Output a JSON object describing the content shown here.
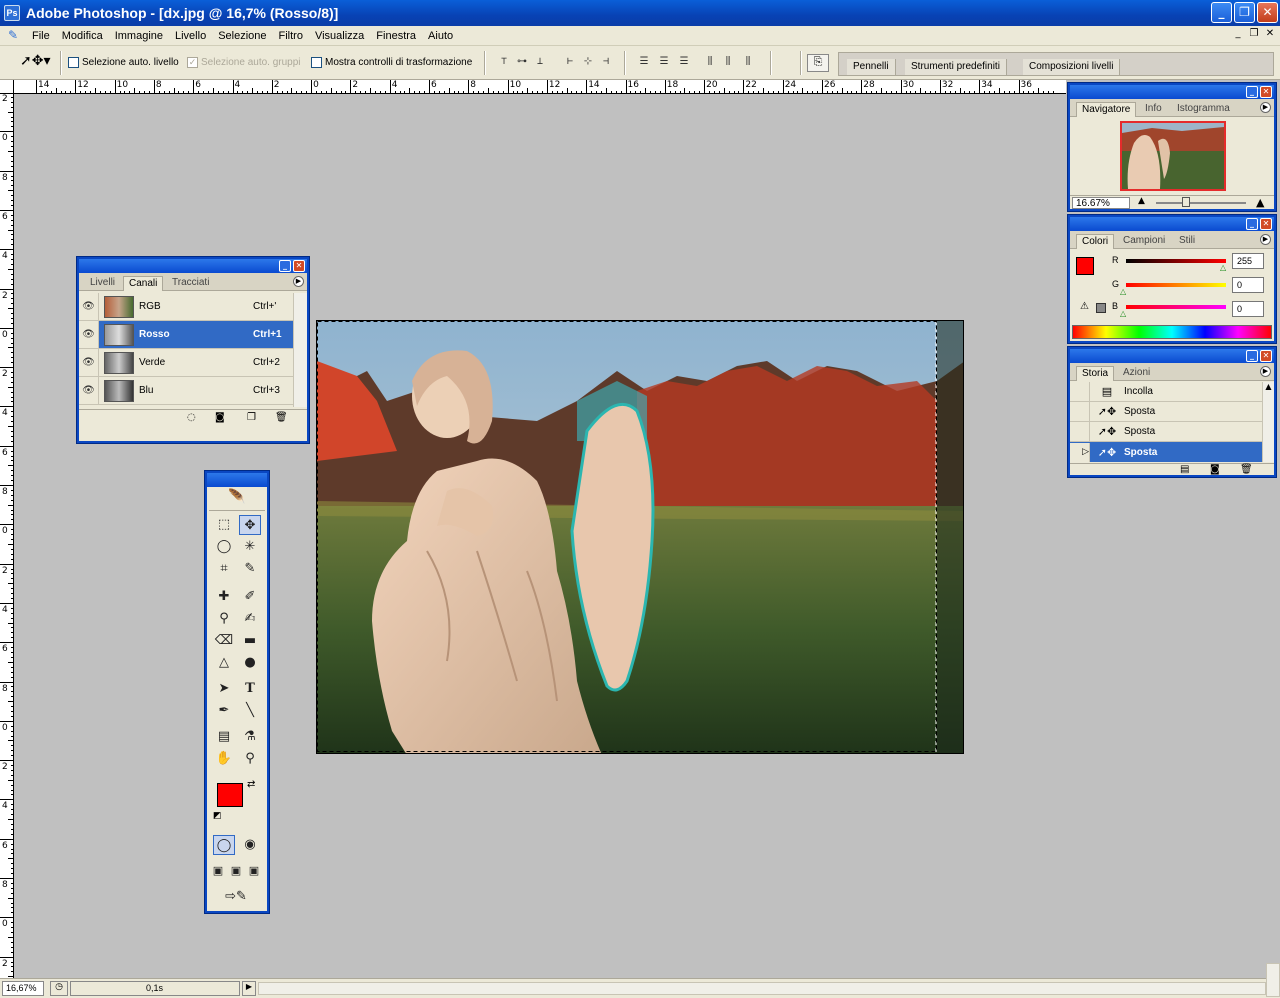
{
  "window": {
    "title": "Adobe Photoshop - [dx.jpg @ 16,7% (Rosso/8)]",
    "minimize": "_",
    "restore": "❐",
    "close": "✕"
  },
  "menu": [
    "File",
    "Modifica",
    "Immagine",
    "Livello",
    "Selezione",
    "Filtro",
    "Visualizza",
    "Finestra",
    "Aiuto"
  ],
  "options": {
    "auto_select_layer": "Selezione auto. livello",
    "auto_select_groups": "Selezione auto. gruppi",
    "show_transform": "Mostra controlli di trasformazione"
  },
  "palette_well": [
    "Pennelli",
    "Strumenti predefiniti",
    "Composizioni livelli"
  ],
  "ruler_h": [
    "14",
    "12",
    "10",
    "8",
    "6",
    "4",
    "2",
    "0",
    "2",
    "4",
    "6",
    "8",
    "10",
    "12",
    "14",
    "16",
    "18",
    "20",
    "22",
    "24",
    "26",
    "28",
    "30",
    "32",
    "34",
    "36"
  ],
  "ruler_v": [
    "2",
    "0",
    "8",
    "6",
    "4",
    "2",
    "0",
    "2",
    "4",
    "6",
    "8",
    "0",
    "2",
    "4",
    "6",
    "8",
    "0",
    "2",
    "4",
    "6",
    "8",
    "0",
    "2"
  ],
  "channels_palette": {
    "tabs": [
      "Livelli",
      "Canali",
      "Tracciati"
    ],
    "rows": [
      {
        "name": "RGB",
        "key": "Ctrl+'"
      },
      {
        "name": "Rosso",
        "key": "Ctrl+1"
      },
      {
        "name": "Verde",
        "key": "Ctrl+2"
      },
      {
        "name": "Blu",
        "key": "Ctrl+3"
      }
    ],
    "selected": "Rosso"
  },
  "navigator_palette": {
    "tabs": [
      "Navigatore",
      "Info",
      "Istogramma"
    ],
    "zoom": "16.67%"
  },
  "color_palette": {
    "tabs": [
      "Colori",
      "Campioni",
      "Stili"
    ],
    "r_label": "R",
    "g_label": "G",
    "b_label": "B",
    "r_value": "255",
    "g_value": "0",
    "b_value": "0",
    "foreground": "#ff0000"
  },
  "history_palette": {
    "tabs": [
      "Storia",
      "Azioni"
    ],
    "items": [
      "Incolla",
      "Sposta",
      "Sposta",
      "Sposta"
    ],
    "selected_index": 3
  },
  "toolbox": {
    "foreground": "#ff0000",
    "background": "#ffffff"
  },
  "status": {
    "zoom": "16,67%",
    "info": "0,1s"
  }
}
